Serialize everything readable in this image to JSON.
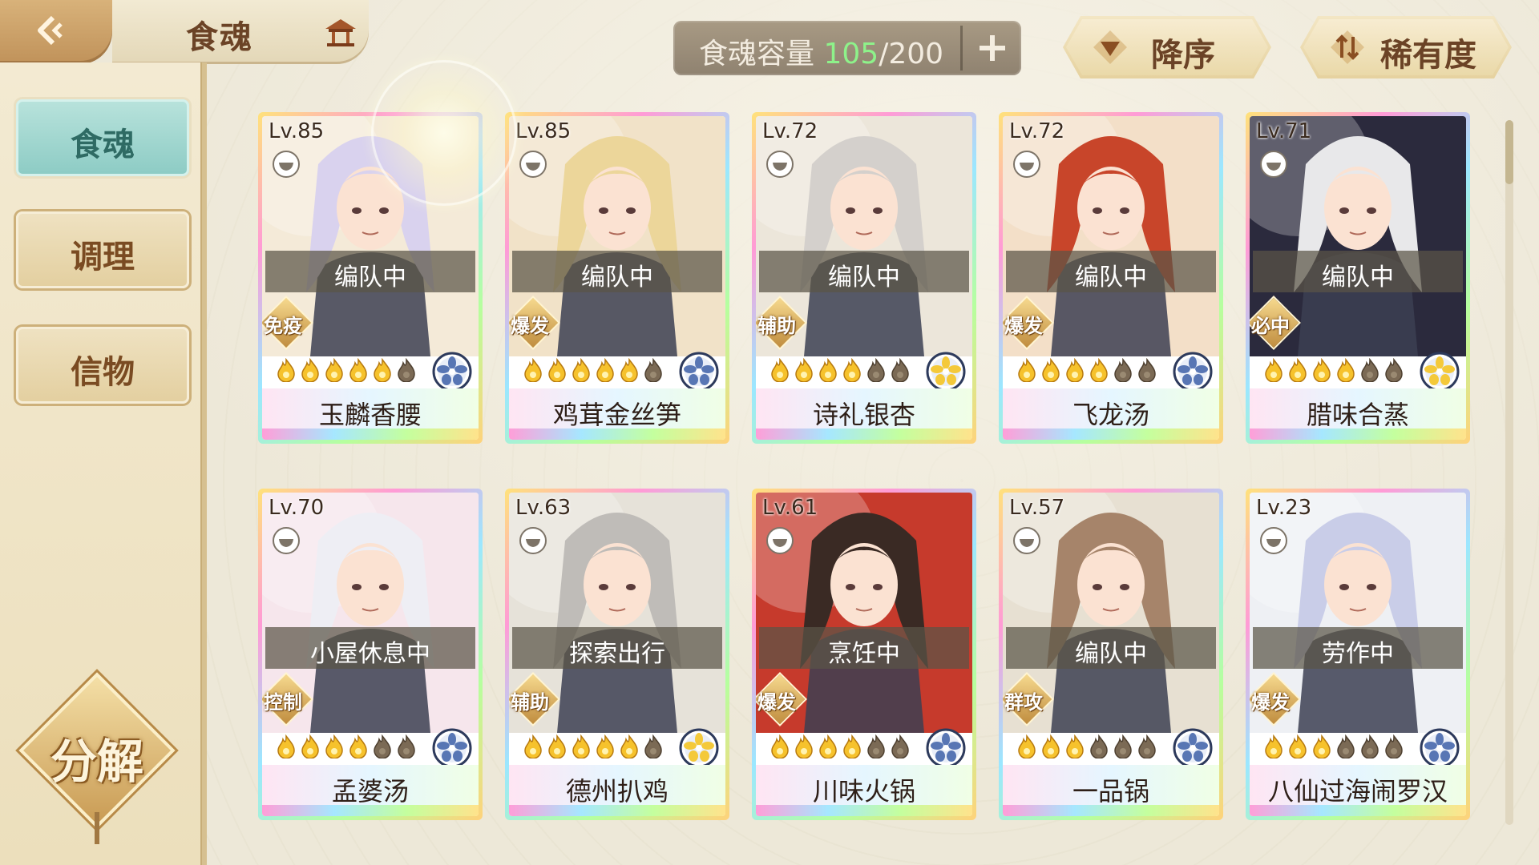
{
  "header": {
    "title": "食魂",
    "capacity_label": "食魂容量",
    "capacity_current": "105",
    "capacity_total": "/200",
    "sort_order_label": "降序",
    "sort_by_label": "稀有度"
  },
  "sidebar": {
    "items": [
      {
        "label": "食魂",
        "active": true
      },
      {
        "label": "调理",
        "active": false
      },
      {
        "label": "信物",
        "active": false
      }
    ],
    "decompose_label": "分解"
  },
  "colors": {
    "accent_green": "#8ef28a",
    "active_tab": "#8ccbc4",
    "brown_text": "#6b4326"
  },
  "cards": [
    {
      "level": "Lv.85",
      "status": "编队中",
      "role": "免疫",
      "stars": 5,
      "name": "玉麟香腰",
      "hair": "#d9d2ee",
      "bg": "#f4ead8",
      "element": "blue"
    },
    {
      "level": "Lv.85",
      "status": "编队中",
      "role": "爆发",
      "stars": 5,
      "name": "鸡茸金丝笋",
      "hair": "#ecd69a",
      "bg": "#f1e2c8",
      "element": "blue"
    },
    {
      "level": "Lv.72",
      "status": "编队中",
      "role": "辅助",
      "stars": 4,
      "name": "诗礼银杏",
      "hair": "#d4d0cc",
      "bg": "#ece6da",
      "element": "gold"
    },
    {
      "level": "Lv.72",
      "status": "编队中",
      "role": "爆发",
      "stars": 4,
      "name": "飞龙汤",
      "hair": "#c8452a",
      "bg": "#f3dfc8",
      "element": "blue"
    },
    {
      "level": "Lv.71",
      "status": "编队中",
      "role": "必中",
      "stars": 4,
      "name": "腊味合蒸",
      "hair": "#e8e8ea",
      "bg": "#2b2a3d",
      "element": "gold"
    },
    {
      "level": "Lv.70",
      "status": "小屋休息中",
      "role": "控制",
      "stars": 4,
      "name": "孟婆汤",
      "hair": "#eeeef4",
      "bg": "#f6e6ec",
      "element": "blue"
    },
    {
      "level": "Lv.63",
      "status": "探索出行",
      "role": "辅助",
      "stars": 5,
      "name": "德州扒鸡",
      "hair": "#bfbcb8",
      "bg": "#e6e2d9",
      "element": "gold"
    },
    {
      "level": "Lv.61",
      "status": "烹饪中",
      "role": "爆发",
      "stars": 4,
      "name": "川味火锅",
      "hair": "#3a2a24",
      "bg": "#c63a2c",
      "element": "blue"
    },
    {
      "level": "Lv.57",
      "status": "编队中",
      "role": "群攻",
      "stars": 3,
      "name": "一品锅",
      "hair": "#a6846a",
      "bg": "#e7e0d2",
      "element": "blue"
    },
    {
      "level": "Lv.23",
      "status": "劳作中",
      "role": "爆发",
      "stars": 3,
      "name": "八仙过海闹罗汉",
      "hair": "#c9cde8",
      "bg": "#eef0f4",
      "element": "blue"
    }
  ],
  "icons": {
    "back": "back-arrow-icon",
    "house": "pavilion-icon",
    "plus": "plus-icon",
    "sort_order": "triangle-down-icon",
    "sort_by": "sort-arrows-icon",
    "bowl": "bowl-icon",
    "flame": "flame-star-icon",
    "element": "element-flower-icon"
  }
}
